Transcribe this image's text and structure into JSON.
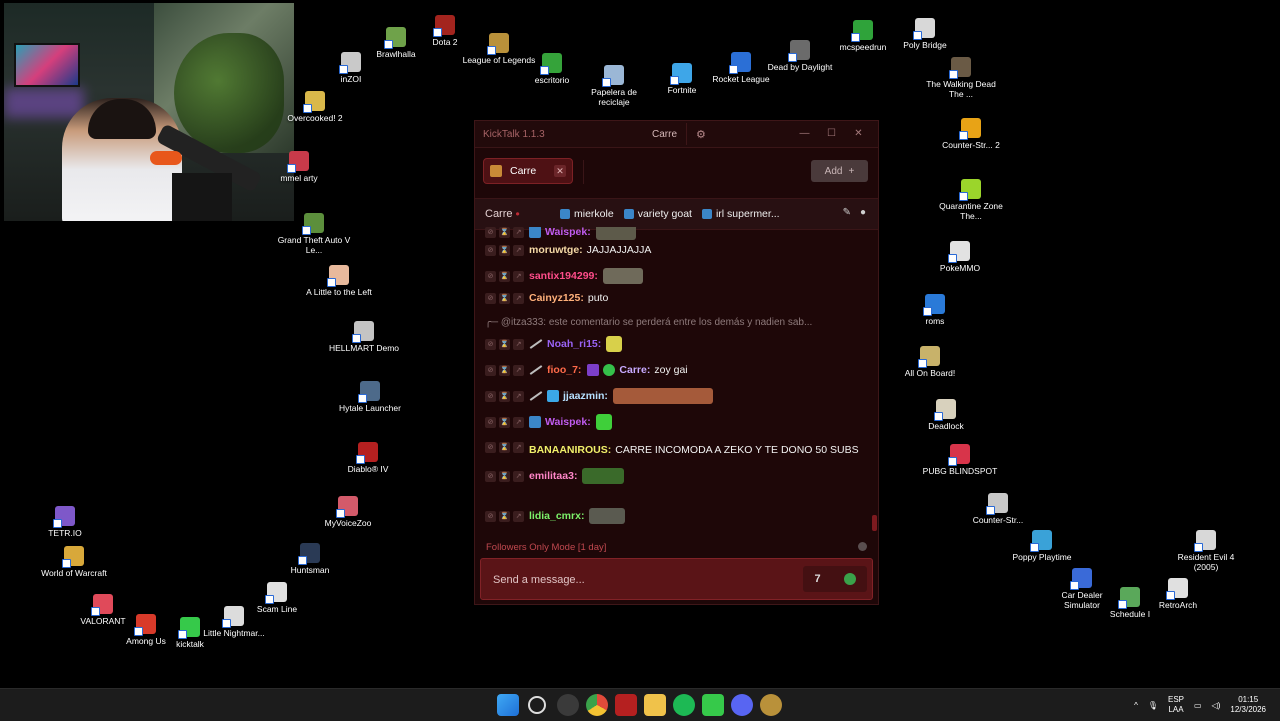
{
  "desktop": {
    "icons": [
      {
        "label": "Brawlhalla",
        "icon": "brawlhalla-icon",
        "color": "#6fa24a"
      },
      {
        "label": "Dota 2",
        "icon": "dota2-icon",
        "color": "#a3241e"
      },
      {
        "label": "inZOI",
        "icon": "inzoi-icon",
        "color": "#c9c9c9"
      },
      {
        "label": "League of Legends",
        "icon": "league-of-legends-icon",
        "color": "#b9913a"
      },
      {
        "label": "escritorio",
        "icon": "tree-icon",
        "color": "#35a33a"
      },
      {
        "label": "Papelera de reciclaje",
        "icon": "recycle-bin-icon",
        "color": "#9bb7d6"
      },
      {
        "label": "Fortnite",
        "icon": "fortnite-icon",
        "color": "#3ea6e8"
      },
      {
        "label": "Rocket League",
        "icon": "rocket-league-icon",
        "color": "#2b6fd6"
      },
      {
        "label": "Dead by Daylight",
        "icon": "dead-by-daylight-icon",
        "color": "#6b6b6b"
      },
      {
        "label": "mcspeedrun",
        "icon": "tree-icon",
        "color": "#2fa33a"
      },
      {
        "label": "Poly Bridge",
        "icon": "poly-bridge-icon",
        "color": "#d8d8d8"
      },
      {
        "label": "The Walking Dead The ...",
        "icon": "walking-dead-icon",
        "color": "#6a5a45"
      },
      {
        "label": "Overcooked! 2",
        "icon": "overcooked-icon",
        "color": "#d9b84a"
      },
      {
        "label": "mmel arty",
        "icon": "game-icon",
        "color": "#c83a4a"
      },
      {
        "label": "Counter-Str... 2",
        "icon": "counter-strike2-icon",
        "color": "#e8a316"
      },
      {
        "label": "Quarantine Zone The...",
        "icon": "quarantine-zone-icon",
        "color": "#9bd52b"
      },
      {
        "label": "Grand Theft Auto V Le...",
        "icon": "gta-v-icon",
        "color": "#5c8f3c"
      },
      {
        "label": "PokeMMO",
        "icon": "pokemmo-icon",
        "color": "#e2e2e2"
      },
      {
        "label": "A Little to the Left",
        "icon": "little-to-the-left-icon",
        "color": "#e8b99c"
      },
      {
        "label": "roms",
        "icon": "internet-explorer-icon",
        "color": "#2a7ad8"
      },
      {
        "label": "HELLMART Demo",
        "icon": "hellmart-icon",
        "color": "#c4c4c4"
      },
      {
        "label": "All On Board!",
        "icon": "all-on-board-icon",
        "color": "#c8b26a"
      },
      {
        "label": "Hytale Launcher",
        "icon": "hytale-icon",
        "color": "#4d6a8a"
      },
      {
        "label": "Deadlock",
        "icon": "deadlock-icon",
        "color": "#d8d1bd"
      },
      {
        "label": "Diablo® IV",
        "icon": "diablo-icon",
        "color": "#b52020"
      },
      {
        "label": "PUBG BLINDSPOT",
        "icon": "pubg-icon",
        "color": "#d8344a"
      },
      {
        "label": "MyVoiceZoo",
        "icon": "myvoicezoo-icon",
        "color": "#d35a6a"
      },
      {
        "label": "Counter-Str...",
        "icon": "counter-strike-icon",
        "color": "#c8c8c8"
      },
      {
        "label": "TETR.IO",
        "icon": "tetrio-icon",
        "color": "#7e58c9"
      },
      {
        "label": "Huntsman",
        "icon": "huntsman-icon",
        "color": "#2a3a55"
      },
      {
        "label": "Poppy Playtime",
        "icon": "poppy-playtime-icon",
        "color": "#3aa2d8"
      },
      {
        "label": "Resident Evil 4 (2005)",
        "icon": "resident-evil-icon",
        "color": "#d8d8d8"
      },
      {
        "label": "World of Warcraft",
        "icon": "wow-icon",
        "color": "#d8a83a"
      },
      {
        "label": "Scam Line",
        "icon": "scam-line-icon",
        "color": "#e0e0e0"
      },
      {
        "label": "Car Dealer Simulator",
        "icon": "car-dealer-icon",
        "color": "#3a6ad8"
      },
      {
        "label": "RetroArch",
        "icon": "retroarch-icon",
        "color": "#e0e0e0"
      },
      {
        "label": "Schedule I",
        "icon": "schedule-icon",
        "color": "#5aa85a"
      },
      {
        "label": "VALORANT",
        "icon": "valorant-icon",
        "color": "#e04a5a"
      },
      {
        "label": "Among Us",
        "icon": "among-us-icon",
        "color": "#d83a2a"
      },
      {
        "label": "kicktalk",
        "icon": "kicktalk-icon",
        "color": "#36c94a"
      },
      {
        "label": "Little Nightmar...",
        "icon": "little-nightmares-icon",
        "color": "#dcdcdc"
      }
    ]
  },
  "kicktalk": {
    "app_title": "KickTalk 1.1.3",
    "title_tab": "Carre",
    "window_buttons": {
      "minimize": "—",
      "maximize": "☐",
      "close": "✕"
    },
    "channel_tab": {
      "label": "Carre",
      "close": "✕"
    },
    "add_button": {
      "label": "Add",
      "icon": "+"
    },
    "chan_bar": {
      "name": "Carre",
      "live_dot": "•",
      "pinned": [
        "mierkole",
        "variety goat",
        "irl supermer..."
      ]
    },
    "messages": [
      {
        "user": "Waispek:",
        "color": "#c05cf0",
        "text": "",
        "emote": "#5d5a4a",
        "emote_w": 40
      },
      {
        "user": "moruwtge:",
        "color": "#f5d9a6",
        "text": "JAJJAJJAJJA"
      },
      {
        "user": "santix194299:",
        "color": "#ff4d8a",
        "text": "",
        "emote": "#6f6a5a",
        "emote_w": 40
      },
      {
        "user": "Cainyz125:",
        "color": "#ffb07a",
        "text": "puto"
      },
      {
        "user": "Noah_ri15:",
        "color": "#9a63f5",
        "text": "",
        "emote": "#d8d04a",
        "emote_w": 16
      },
      {
        "user": "fioo_7:",
        "color": "#ff6a4a",
        "text": "zoy gai",
        "mention": "Carre:"
      },
      {
        "user": "jjaazmin:",
        "color": "#b6e0ff",
        "text": "",
        "emote": "#a55a3a",
        "emote_w": 100
      },
      {
        "user": "Waispek:",
        "color": "#c05cf0",
        "text": "",
        "emote": "#3fcf3a",
        "emote_w": 16
      },
      {
        "user": "BANAANIROUS:",
        "color": "#f0f06a",
        "text": "CARRE INCOMODA A ZEKO Y TE DONO 50 SUBS"
      },
      {
        "user": "emilitaa3:",
        "color": "#ff86c8",
        "text": "",
        "emote": "#3a6a2a",
        "emote_w": 42
      },
      {
        "user": "lidia_cmrx:",
        "color": "#7cf06a",
        "text": "",
        "emote": "#5a5a50",
        "emote_w": 36
      }
    ],
    "reply_line": "@itza333: este comentario se perderá entre los demás y nadien sab...",
    "followers_mode": "Followers Only Mode [1 day]",
    "input_placeholder": "Send a message..."
  },
  "taskbar": {
    "lang_top": "ESP",
    "lang_bottom": "LAA",
    "time": "01:15",
    "date": "12/3/2026",
    "up_arrow": "^"
  }
}
